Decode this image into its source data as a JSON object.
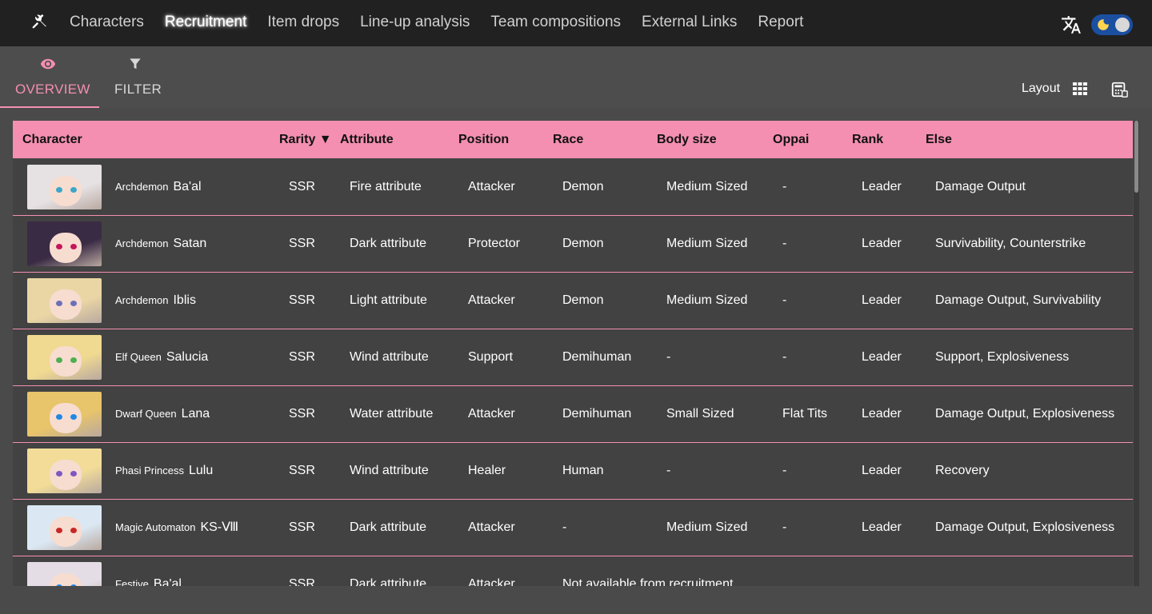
{
  "nav": {
    "items": [
      {
        "label": "Characters",
        "active": false
      },
      {
        "label": "Recruitment",
        "active": true
      },
      {
        "label": "Item drops",
        "active": false
      },
      {
        "label": "Line-up analysis",
        "active": false
      },
      {
        "label": "Team compositions",
        "active": false
      },
      {
        "label": "External Links",
        "active": false
      },
      {
        "label": "Report",
        "active": false
      }
    ]
  },
  "subtabs": {
    "overview": "OVERVIEW",
    "filter": "FILTER",
    "layout_label": "Layout"
  },
  "colors": {
    "accent": "#f48fb1",
    "topbar": "#212121",
    "toggle": "#1b4fa0"
  },
  "icons": {
    "tools": "tools-icon",
    "translate": "translate-icon",
    "theme": "moon-icon",
    "overview": "eye-icon",
    "filter": "filter-icon",
    "grid": "grid-icon",
    "calc": "calculator-icon"
  },
  "table": {
    "headers": {
      "character": "Character",
      "rarity": "Rarity ▼",
      "attribute": "Attribute",
      "position": "Position",
      "race": "Race",
      "body": "Body size",
      "oppai": "Oppai",
      "rank": "Rank",
      "else": "Else"
    },
    "rows": [
      {
        "title": "Archdemon",
        "name": "Ba'al",
        "rarity": "SSR",
        "attribute": "Fire attribute",
        "position": "Attacker",
        "race": "Demon",
        "body": "Medium Sized",
        "oppai": "-",
        "rank": "Leader",
        "else": "Damage Output"
      },
      {
        "title": "Archdemon",
        "name": "Satan",
        "rarity": "SSR",
        "attribute": "Dark attribute",
        "position": "Protector",
        "race": "Demon",
        "body": "Medium Sized",
        "oppai": "-",
        "rank": "Leader",
        "else": "Survivability, Counterstrike"
      },
      {
        "title": "Archdemon",
        "name": "Iblis",
        "rarity": "SSR",
        "attribute": "Light attribute",
        "position": "Attacker",
        "race": "Demon",
        "body": "Medium Sized",
        "oppai": "-",
        "rank": "Leader",
        "else": "Damage Output, Survivability"
      },
      {
        "title": "Elf Queen",
        "name": "Salucia",
        "rarity": "SSR",
        "attribute": "Wind attribute",
        "position": "Support",
        "race": "Demihuman",
        "body": "-",
        "oppai": "-",
        "rank": "Leader",
        "else": "Support, Explosiveness"
      },
      {
        "title": "Dwarf Queen",
        "name": "Lana",
        "rarity": "SSR",
        "attribute": "Water attribute",
        "position": "Attacker",
        "race": "Demihuman",
        "body": "Small Sized",
        "oppai": "Flat Tits",
        "rank": "Leader",
        "else": "Damage Output, Explosiveness"
      },
      {
        "title": "Phasi Princess",
        "name": "Lulu",
        "rarity": "SSR",
        "attribute": "Wind attribute",
        "position": "Healer",
        "race": "Human",
        "body": "-",
        "oppai": "-",
        "rank": "Leader",
        "else": "Recovery"
      },
      {
        "title": "Magic Automaton",
        "name": "KS-Ⅷ",
        "rarity": "SSR",
        "attribute": "Dark attribute",
        "position": "Attacker",
        "race": "-",
        "body": "Medium Sized",
        "oppai": "-",
        "rank": "Leader",
        "else": "Damage Output, Explosiveness"
      },
      {
        "title": "Festive",
        "name": "Ba'al",
        "rarity": "SSR",
        "attribute": "Dark attribute",
        "position": "Attacker",
        "race": "Not available from recruitment",
        "body": "",
        "oppai": "",
        "rank": "",
        "else": ""
      }
    ]
  }
}
